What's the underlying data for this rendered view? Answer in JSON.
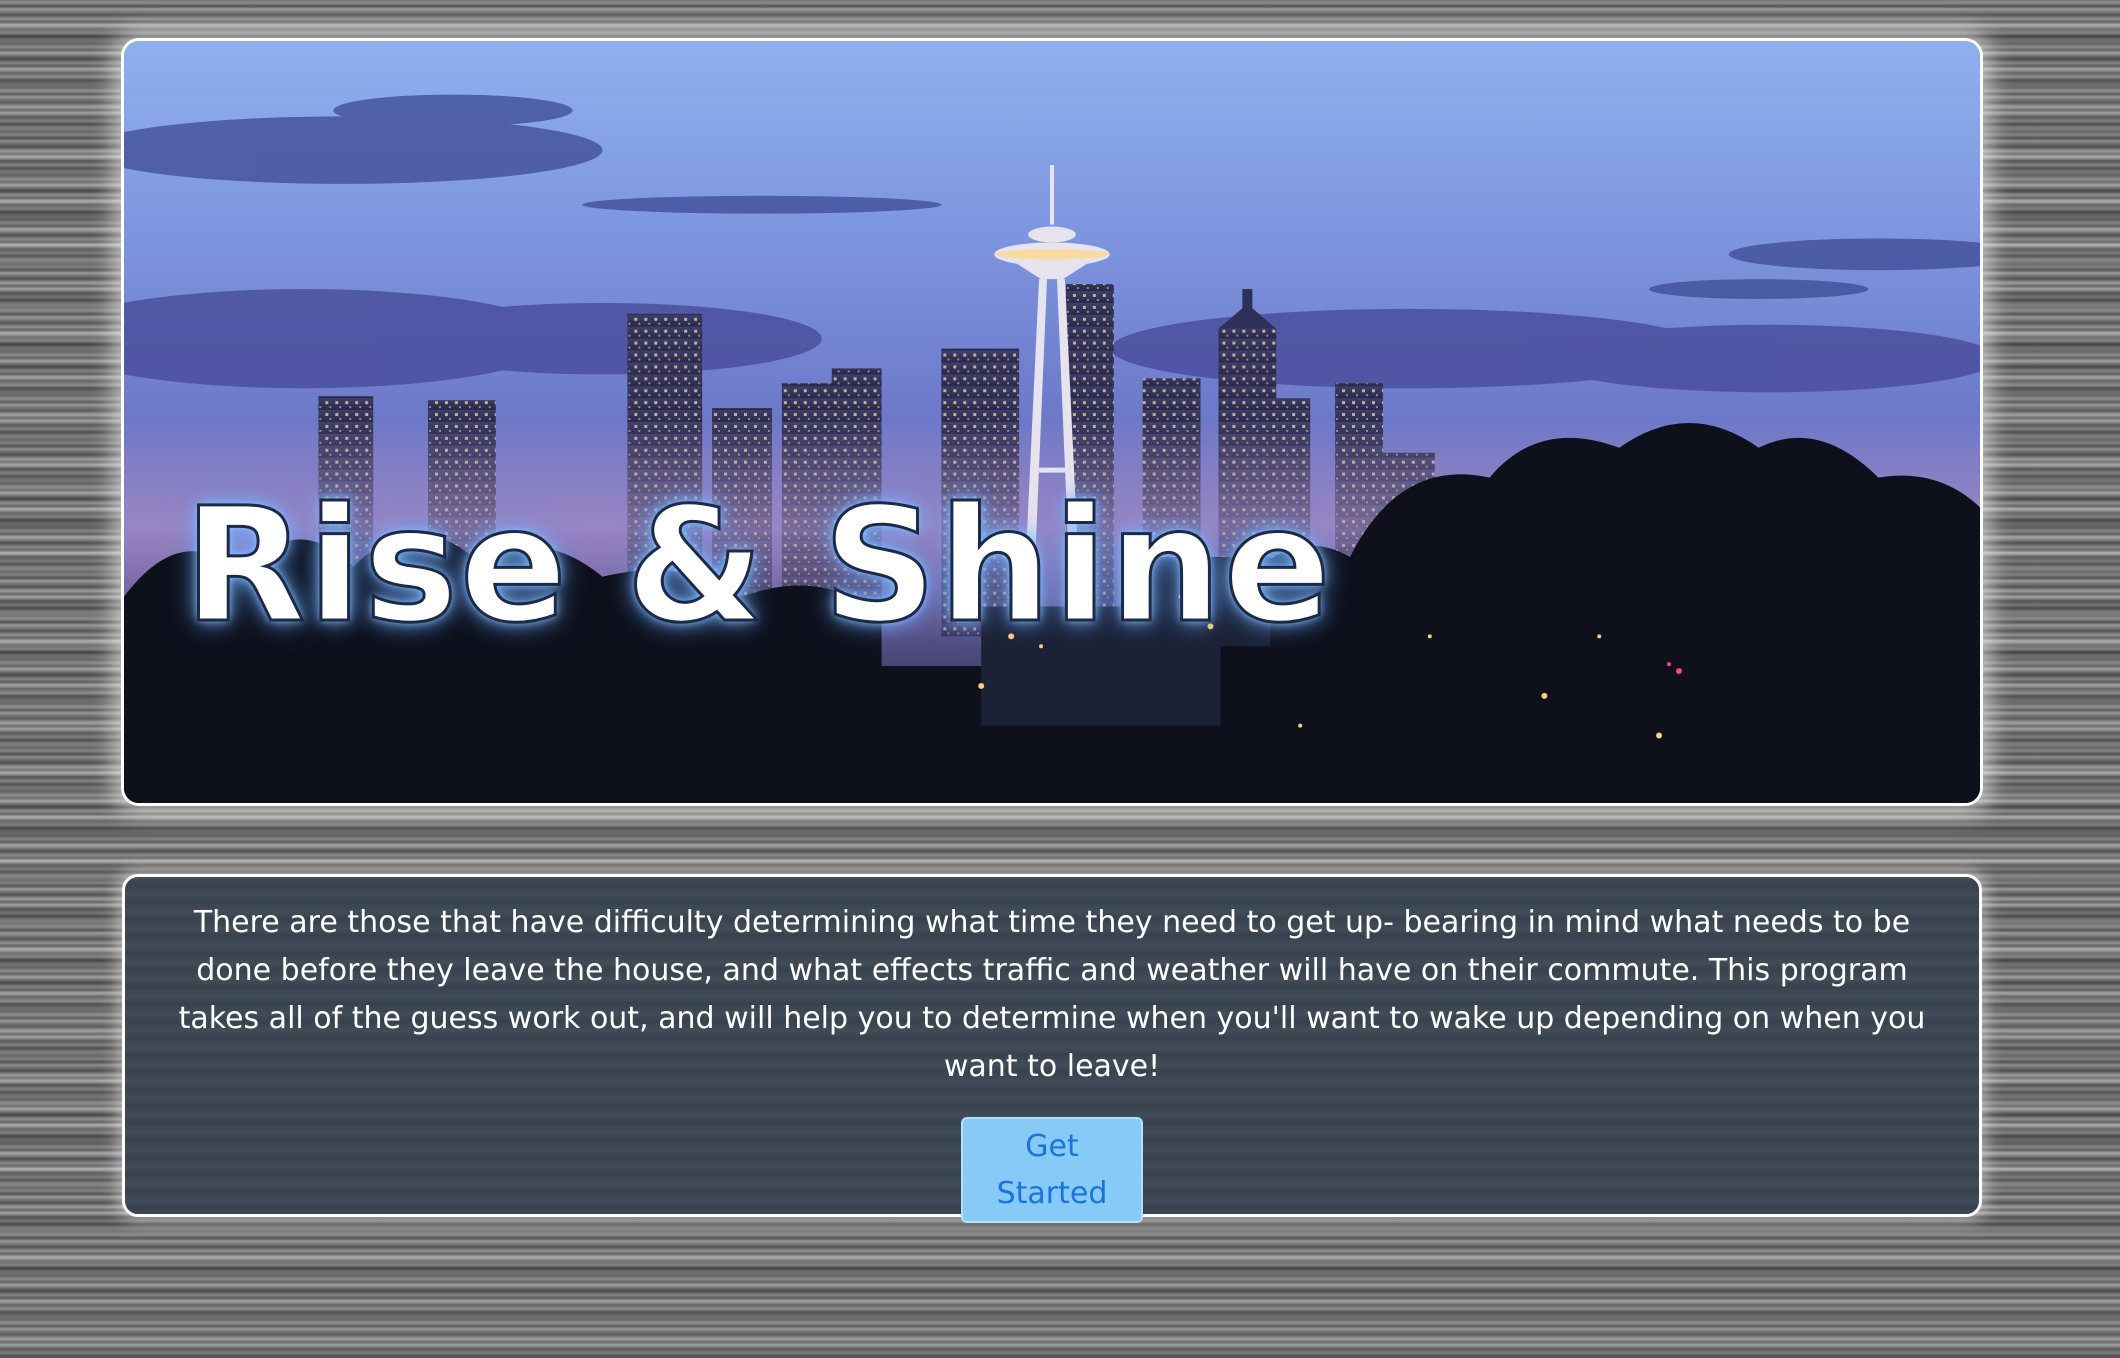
{
  "hero": {
    "title": "Rise & Shine",
    "image_description_icon": "seattle-skyline-image"
  },
  "intro": {
    "text": "There are those that have difficulty determining what time they need to get up- bearing in mind what needs to be done before they leave the house, and what effects traffic and weather will have on their commute. This program takes all of the guess work out, and will help you to determine when you'll want to wake up depending on when you want to leave!",
    "button_label": "Get Started"
  },
  "colors": {
    "card_background": "#3a4652",
    "button_background": "#87c9f7",
    "button_text": "#1a74e0",
    "border": "#ffffff"
  }
}
